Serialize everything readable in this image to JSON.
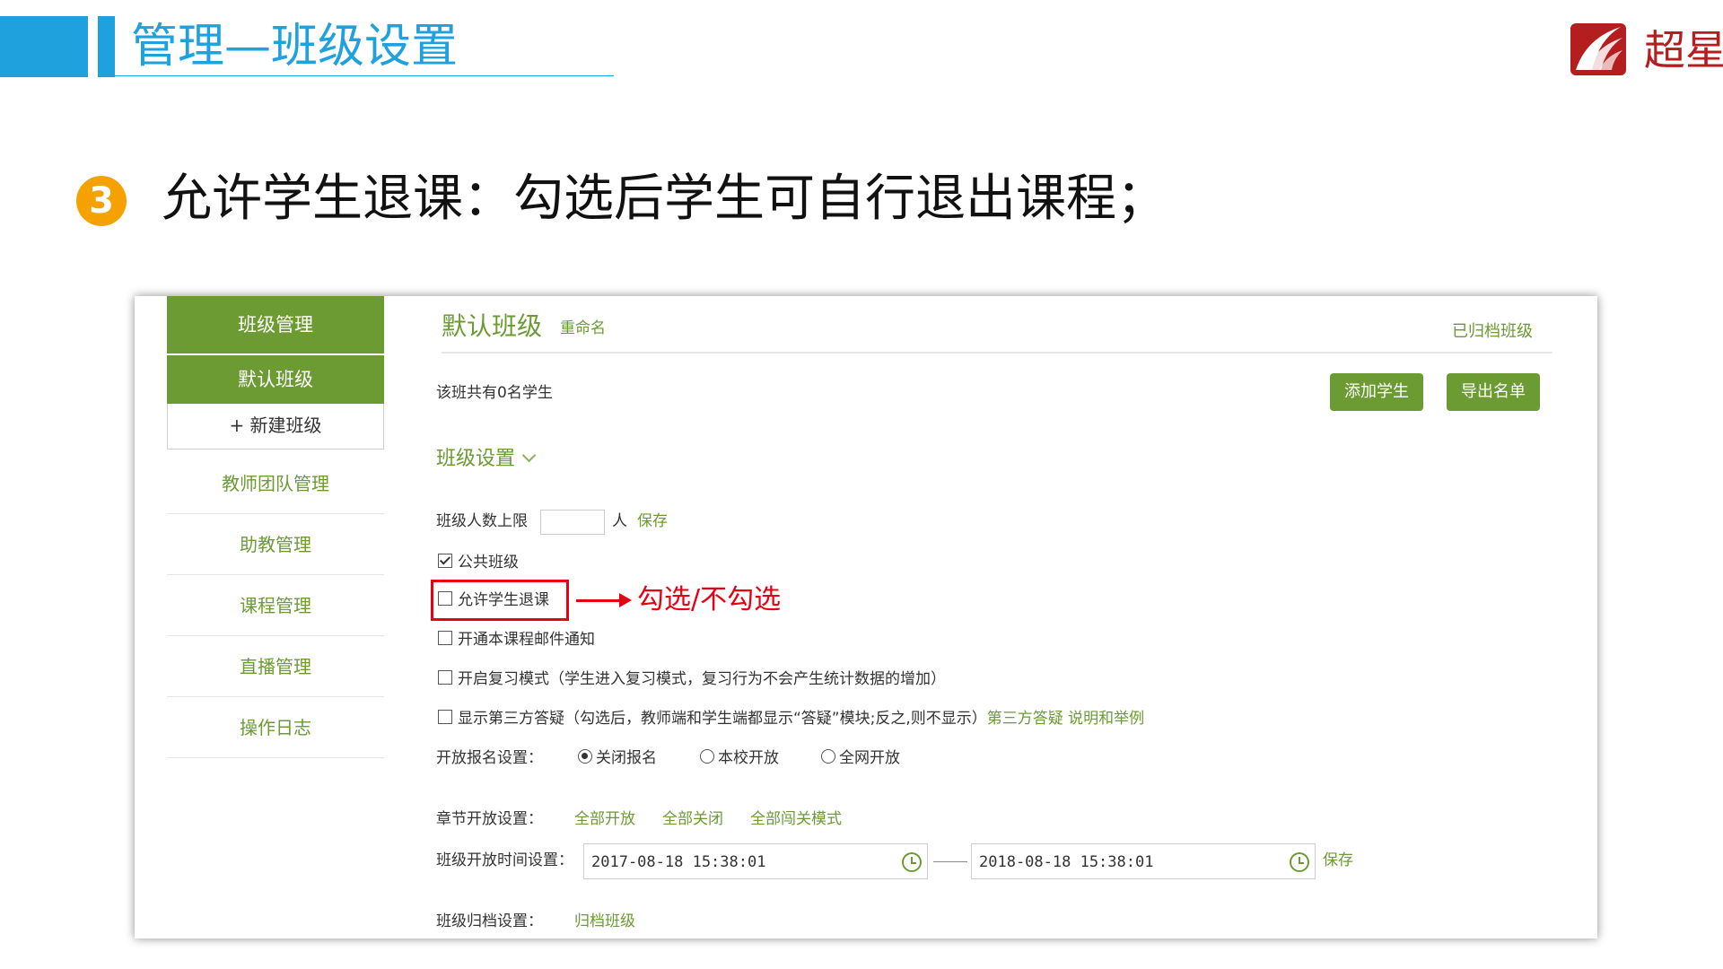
{
  "slide": {
    "title": "管理—班级设置",
    "logo_text": "超星",
    "bullet_number": "3",
    "bullet_text": "允许学生退课：勾选后学生可自行退出课程；",
    "annotation": "勾选/不勾选"
  },
  "colors": {
    "accent_blue": "#1ea1dd",
    "accent_green": "#6b9b32",
    "highlight_red": "#e60012",
    "bullet_orange": "#f5a200"
  },
  "sidebar": {
    "header": "班级管理",
    "default_class": "默认班级",
    "new_class": "+ 新建班级",
    "items": [
      {
        "label": "教师团队管理"
      },
      {
        "label": "助教管理"
      },
      {
        "label": "课程管理"
      },
      {
        "label": "直播管理"
      },
      {
        "label": "操作日志"
      }
    ]
  },
  "main": {
    "class_name": "默认班级",
    "rename": "重命名",
    "archived_link": "已归档班级",
    "student_count": "该班共有0名学生",
    "add_student": "添加学生",
    "export_list": "导出名单"
  },
  "settings": {
    "section_title": "班级设置",
    "capacity_label": "班级人数上限",
    "capacity_value": "",
    "capacity_unit": "人",
    "save": "保存",
    "public_class": {
      "label": "公共班级",
      "checked": true
    },
    "allow_drop": {
      "label": "允许学生退课",
      "checked": false
    },
    "email_notify": {
      "label": "开通本课程邮件通知",
      "checked": false
    },
    "review_mode": {
      "label": "开启复习模式（学生进入复习模式，复习行为不会产生统计数据的增加）",
      "checked": false
    },
    "third_party_qa": {
      "label": "显示第三方答疑（勾选后，教师端和学生端都显示“答疑”模块;反之,则不显示）",
      "link": "第三方答疑 说明和举例",
      "checked": false
    },
    "registration": {
      "label": "开放报名设置：",
      "options": [
        "关闭报名",
        "本校开放",
        "全网开放"
      ],
      "selected": "关闭报名"
    },
    "chapter_open": {
      "label": "章节开放设置：",
      "links": [
        "全部开放",
        "全部关闭",
        "全部闯关模式"
      ]
    },
    "open_time": {
      "label": "班级开放时间设置：",
      "start": "2017-08-18 15:38:01",
      "end": "2018-08-18 15:38:01",
      "save": "保存"
    },
    "archive": {
      "label": "班级归档设置：",
      "link": "归档班级"
    }
  }
}
